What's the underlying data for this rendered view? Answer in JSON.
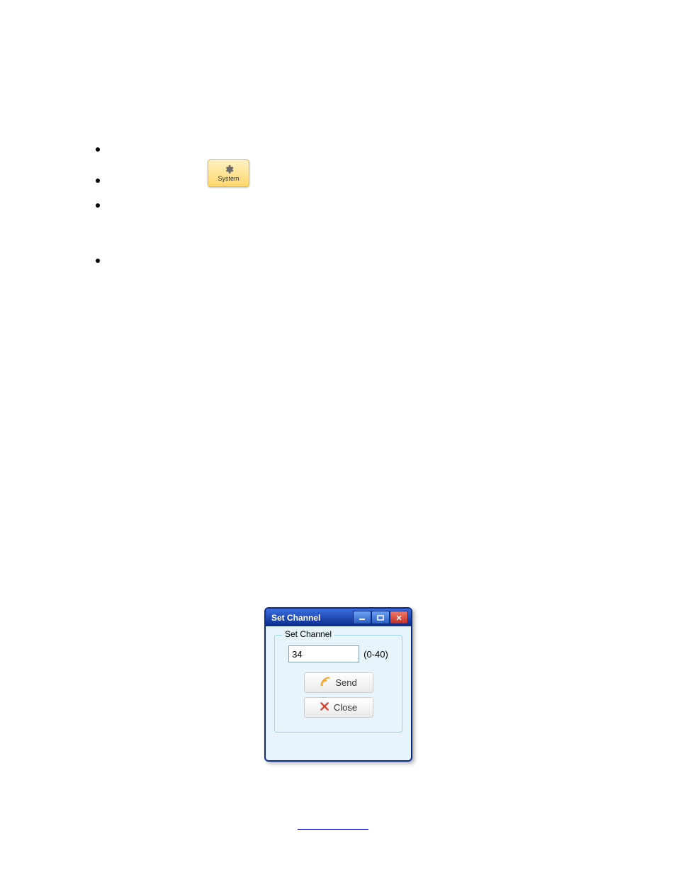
{
  "bullets": {
    "positions": [
      0,
      44,
      80,
      158
    ]
  },
  "system_button": {
    "label": "System"
  },
  "dialog": {
    "title": "Set Channel",
    "fieldset_legend": "Set Channel",
    "channel_value": "34",
    "range_text": "(0-40)",
    "send_label": "Send",
    "close_label": "Close"
  }
}
